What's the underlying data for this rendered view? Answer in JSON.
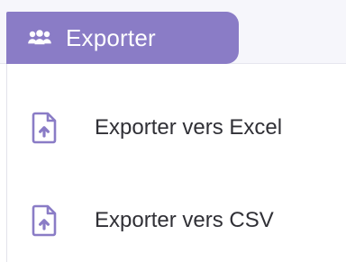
{
  "colors": {
    "tab_background": "#8a7cc6",
    "tab_text": "#ffffff",
    "menu_text": "#303036",
    "menu_icon": "#8a7cc6",
    "top_strip_background": "#f6f6fb"
  },
  "tab": {
    "icon": "group-users-icon",
    "label": "Exporter"
  },
  "menu": {
    "items": [
      {
        "icon": "file-upload-icon",
        "label": "Exporter vers Excel"
      },
      {
        "icon": "file-upload-icon",
        "label": "Exporter vers CSV"
      }
    ]
  }
}
